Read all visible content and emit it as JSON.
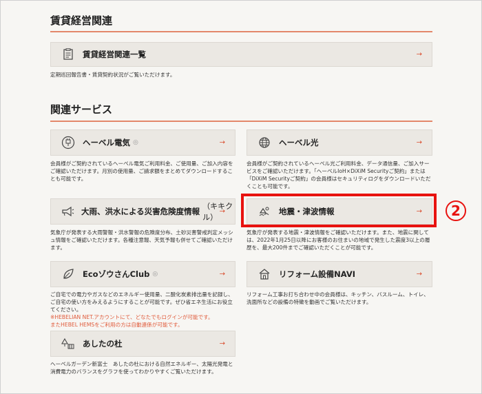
{
  "rental_section": {
    "title": "賃貸経営関連",
    "card": {
      "label": "賃貸経営関連一覧",
      "icon": "document-icon"
    },
    "description": "定期巡回報告書・賃貸契約状況がご覧いただけます。"
  },
  "services_section": {
    "title": "関連サービス",
    "cards": [
      {
        "label": "ヘーベル電気",
        "icon": "plug-icon",
        "ext": "◎",
        "description": "会員様がご契約されているヘーベル電気ご利用料金、ご使用量、ご加入内容をご確認いただけます。月別の使用量、ご請求額をまとめてダウンロードすることも可能です。"
      },
      {
        "label": "ヘーベル光",
        "icon": "globe-icon",
        "description": "会員様がご契約されているヘーベル光ご利用料金、データ通信量、ご加入サービスをご確認いただけます。「ヘーベルIoH×DiXiM Securityご契約」または「DiXiM Securityご契約」の会員様はセキュリティログをダウンロードいただくことも可能です。"
      },
      {
        "label": "大雨、洪水による災害危険度情報",
        "sublabel": "（キキクル）",
        "icon": "megaphone-icon",
        "description": "気象庁が発表する大雨警報・洪水警報の危険度分布、土砂災害警戒判定メッシュ情報をご確認いただけます。各種注意報、天気予報も併せてご確認いただけます。"
      },
      {
        "label": "地震・津波情報",
        "icon": "quake-icon",
        "description": "気象庁が発表する地震・津波情報をご確認いただけます。また、地震に関しては、2022年1月25日以降にお客様のお住まいの地域で発生した震度3以上の履歴を、最大200件までご確認いただくことが可能です。"
      },
      {
        "label": "EcoゾウさんClub",
        "icon": "leaf-icon",
        "ext": "◎",
        "description": "ご自宅での電力やガスなどのエネルギー使用量、二酸化炭素排出量を記録し、ご自宅の使い方をみえるようにすることが可能です。ぜひ省エネ生活にお役立てください。",
        "note1": "※HEBELIAN NET.アカウントにて、どなたでもログインが可能です。",
        "note2": "またHEBEL HEMSをご利用の方は自動連係が可能です。"
      },
      {
        "label": "リフォーム設備NAVI",
        "icon": "house-icon",
        "description": "リフォーム工事お打ち合わせ中の会員様は、キッチン、バスルーム、トイレ、洗面所などの設備の特徴を動画でご覧いただけます。"
      },
      {
        "label": "あしたの杜",
        "icon": "tree-icon",
        "description": "ヘーベルガーデン新富士　あしたの杜における自然エネルギー、太陽光発電と消費電力のバランスをグラフを使ってわかりやすくご覧いただけます。"
      }
    ]
  },
  "arrow_glyph": "→",
  "step_marker": "2",
  "highlight_color": "#e8120f"
}
